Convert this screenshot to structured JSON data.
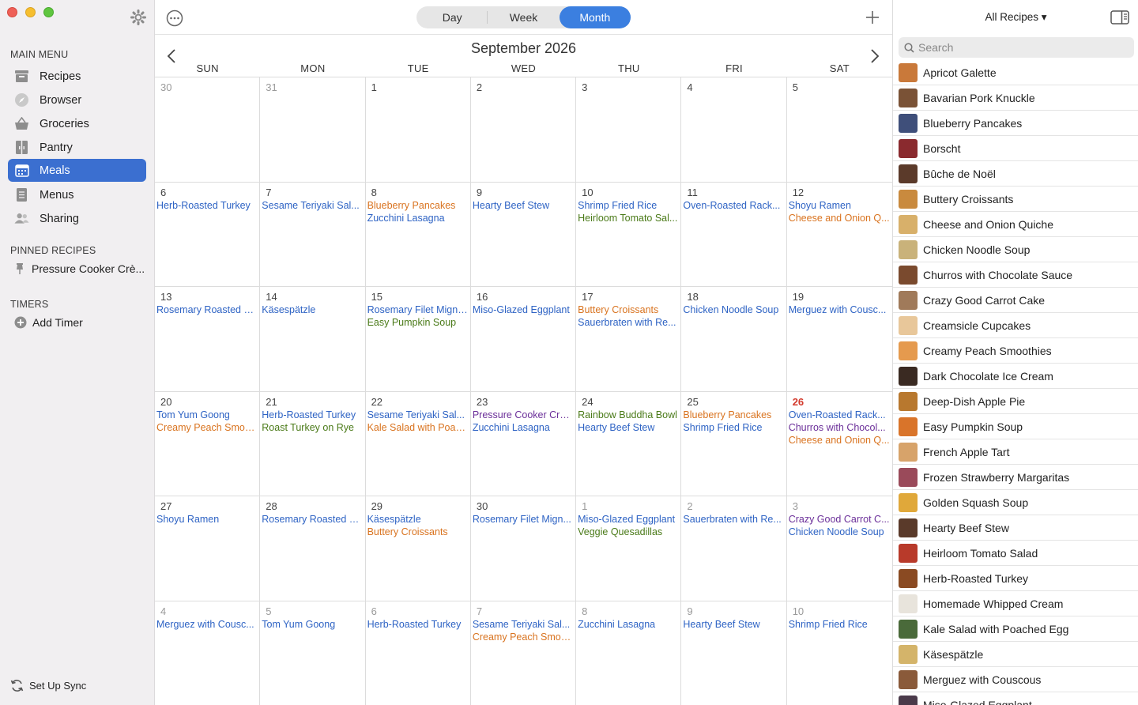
{
  "sidebar": {
    "main_menu_title": "MAIN MENU",
    "items": [
      {
        "label": "Recipes",
        "icon": "recipes-icon"
      },
      {
        "label": "Browser",
        "icon": "compass-icon"
      },
      {
        "label": "Groceries",
        "icon": "basket-icon"
      },
      {
        "label": "Pantry",
        "icon": "pantry-icon"
      },
      {
        "label": "Meals",
        "icon": "calendar-icon"
      },
      {
        "label": "Menus",
        "icon": "menu-icon"
      },
      {
        "label": "Sharing",
        "icon": "people-icon"
      }
    ],
    "active_item": "Meals",
    "pinned_title": "PINNED RECIPES",
    "pinned_item": "Pressure Cooker Crè...",
    "timers_title": "TIMERS",
    "add_timer": "Add Timer",
    "sync": "Set Up Sync"
  },
  "toolbar": {
    "view_options": [
      "Day",
      "Week",
      "Month"
    ],
    "active_view": "Month"
  },
  "calendar": {
    "title": "September 2026",
    "weekdays": [
      "SUN",
      "MON",
      "TUE",
      "WED",
      "THU",
      "FRI",
      "SAT"
    ],
    "colors": {
      "blue": "#2e63c4",
      "orange": "#d9731f",
      "green": "#4a7a18",
      "purple": "#6b2f99"
    },
    "weeks": [
      [
        {
          "day": "30",
          "dim": true,
          "meals": []
        },
        {
          "day": "31",
          "dim": true,
          "meals": []
        },
        {
          "day": "1",
          "meals": []
        },
        {
          "day": "2",
          "meals": []
        },
        {
          "day": "3",
          "meals": []
        },
        {
          "day": "4",
          "meals": []
        },
        {
          "day": "5",
          "meals": []
        }
      ],
      [
        {
          "day": "6",
          "meals": [
            {
              "name": "Herb-Roasted Turkey",
              "color": "blue"
            }
          ]
        },
        {
          "day": "7",
          "meals": [
            {
              "name": "Sesame Teriyaki Sal...",
              "color": "blue"
            }
          ]
        },
        {
          "day": "8",
          "meals": [
            {
              "name": "Blueberry Pancakes",
              "color": "orange"
            },
            {
              "name": "Zucchini Lasagna",
              "color": "blue"
            }
          ]
        },
        {
          "day": "9",
          "meals": [
            {
              "name": "Hearty Beef Stew",
              "color": "blue"
            }
          ]
        },
        {
          "day": "10",
          "meals": [
            {
              "name": "Shrimp Fried Rice",
              "color": "blue"
            },
            {
              "name": "Heirloom Tomato Sal...",
              "color": "green"
            }
          ]
        },
        {
          "day": "11",
          "meals": [
            {
              "name": "Oven-Roasted Rack...",
              "color": "blue"
            }
          ]
        },
        {
          "day": "12",
          "meals": [
            {
              "name": "Shoyu Ramen",
              "color": "blue"
            },
            {
              "name": "Cheese and Onion Q...",
              "color": "orange"
            }
          ]
        }
      ],
      [
        {
          "day": "13",
          "meals": [
            {
              "name": "Rosemary Roasted C...",
              "color": "blue"
            }
          ]
        },
        {
          "day": "14",
          "meals": [
            {
              "name": "Käsespätzle",
              "color": "blue"
            }
          ]
        },
        {
          "day": "15",
          "meals": [
            {
              "name": "Rosemary Filet Mignon",
              "color": "blue"
            },
            {
              "name": "Easy Pumpkin Soup",
              "color": "green"
            }
          ]
        },
        {
          "day": "16",
          "meals": [
            {
              "name": "Miso-Glazed Eggplant",
              "color": "blue"
            }
          ]
        },
        {
          "day": "17",
          "meals": [
            {
              "name": "Buttery Croissants",
              "color": "orange"
            },
            {
              "name": "Sauerbraten with Re...",
              "color": "blue"
            }
          ]
        },
        {
          "day": "18",
          "meals": [
            {
              "name": "Chicken Noodle Soup",
              "color": "blue"
            }
          ]
        },
        {
          "day": "19",
          "meals": [
            {
              "name": "Merguez with Cousc...",
              "color": "blue"
            }
          ]
        }
      ],
      [
        {
          "day": "20",
          "meals": [
            {
              "name": "Tom Yum Goong",
              "color": "blue"
            },
            {
              "name": "Creamy Peach Smoo...",
              "color": "orange"
            }
          ]
        },
        {
          "day": "21",
          "meals": [
            {
              "name": "Herb-Roasted Turkey",
              "color": "blue"
            },
            {
              "name": "Roast Turkey on Rye",
              "color": "green"
            }
          ]
        },
        {
          "day": "22",
          "meals": [
            {
              "name": "Sesame Teriyaki Sal...",
              "color": "blue"
            },
            {
              "name": "Kale Salad with Poac...",
              "color": "orange"
            }
          ]
        },
        {
          "day": "23",
          "meals": [
            {
              "name": "Pressure Cooker Crè...",
              "color": "purple"
            },
            {
              "name": "Zucchini Lasagna",
              "color": "blue"
            }
          ]
        },
        {
          "day": "24",
          "meals": [
            {
              "name": "Rainbow Buddha Bowl",
              "color": "green"
            },
            {
              "name": "Hearty Beef Stew",
              "color": "blue"
            }
          ]
        },
        {
          "day": "25",
          "meals": [
            {
              "name": "Blueberry Pancakes",
              "color": "orange"
            },
            {
              "name": "Shrimp Fried Rice",
              "color": "blue"
            }
          ]
        },
        {
          "day": "26",
          "today": true,
          "meals": [
            {
              "name": "Oven-Roasted Rack...",
              "color": "blue"
            },
            {
              "name": "Churros with Chocol...",
              "color": "purple"
            },
            {
              "name": "Cheese and Onion Q...",
              "color": "orange"
            }
          ]
        }
      ],
      [
        {
          "day": "27",
          "meals": [
            {
              "name": "Shoyu Ramen",
              "color": "blue"
            }
          ]
        },
        {
          "day": "28",
          "meals": [
            {
              "name": "Rosemary Roasted C...",
              "color": "blue"
            }
          ]
        },
        {
          "day": "29",
          "meals": [
            {
              "name": "Käsespätzle",
              "color": "blue"
            },
            {
              "name": "Buttery Croissants",
              "color": "orange"
            }
          ]
        },
        {
          "day": "30",
          "meals": [
            {
              "name": "Rosemary Filet Mign...",
              "color": "blue"
            }
          ]
        },
        {
          "day": "1",
          "dim": true,
          "meals": [
            {
              "name": "Miso-Glazed Eggplant",
              "color": "blue"
            },
            {
              "name": "Veggie Quesadillas",
              "color": "green"
            }
          ]
        },
        {
          "day": "2",
          "dim": true,
          "meals": [
            {
              "name": "Sauerbraten with Re...",
              "color": "blue"
            }
          ]
        },
        {
          "day": "3",
          "dim": true,
          "meals": [
            {
              "name": "Crazy Good Carrot C...",
              "color": "purple"
            },
            {
              "name": "Chicken Noodle Soup",
              "color": "blue"
            }
          ]
        }
      ],
      [
        {
          "day": "4",
          "dim": true,
          "meals": [
            {
              "name": "Merguez with Cousc...",
              "color": "blue"
            }
          ]
        },
        {
          "day": "5",
          "dim": true,
          "meals": [
            {
              "name": "Tom Yum Goong",
              "color": "blue"
            }
          ]
        },
        {
          "day": "6",
          "dim": true,
          "meals": [
            {
              "name": "Herb-Roasted Turkey",
              "color": "blue"
            }
          ]
        },
        {
          "day": "7",
          "dim": true,
          "meals": [
            {
              "name": "Sesame Teriyaki Sal...",
              "color": "blue"
            },
            {
              "name": "Creamy Peach Smoo...",
              "color": "orange"
            }
          ]
        },
        {
          "day": "8",
          "dim": true,
          "meals": [
            {
              "name": "Zucchini Lasagna",
              "color": "blue"
            }
          ]
        },
        {
          "day": "9",
          "dim": true,
          "meals": [
            {
              "name": "Hearty Beef Stew",
              "color": "blue"
            }
          ]
        },
        {
          "day": "10",
          "dim": true,
          "meals": [
            {
              "name": "Shrimp Fried Rice",
              "color": "blue"
            }
          ]
        }
      ]
    ]
  },
  "recipes_panel": {
    "filter_label": "All Recipes ▾",
    "search_placeholder": "Search",
    "recipes": [
      {
        "name": "Apricot Galette",
        "thumb": "#c9793a"
      },
      {
        "name": "Bavarian Pork Knuckle",
        "thumb": "#7a5236"
      },
      {
        "name": "Blueberry Pancakes",
        "thumb": "#3f4f7a"
      },
      {
        "name": "Borscht",
        "thumb": "#8a2a2e"
      },
      {
        "name": "Bûche de Noël",
        "thumb": "#5b3a2a"
      },
      {
        "name": "Buttery Croissants",
        "thumb": "#c98a3e"
      },
      {
        "name": "Cheese and Onion Quiche",
        "thumb": "#d8b06a"
      },
      {
        "name": "Chicken Noodle Soup",
        "thumb": "#c9b27a"
      },
      {
        "name": "Churros with Chocolate Sauce",
        "thumb": "#7a4a2e"
      },
      {
        "name": "Crazy Good Carrot Cake",
        "thumb": "#a07a5a"
      },
      {
        "name": "Creamsicle Cupcakes",
        "thumb": "#e8c79a"
      },
      {
        "name": "Creamy Peach Smoothies",
        "thumb": "#e59a4e"
      },
      {
        "name": "Dark Chocolate Ice Cream",
        "thumb": "#3a2a22"
      },
      {
        "name": "Deep-Dish Apple Pie",
        "thumb": "#b8782e"
      },
      {
        "name": "Easy Pumpkin Soup",
        "thumb": "#d9742a"
      },
      {
        "name": "French Apple Tart",
        "thumb": "#d7a36a"
      },
      {
        "name": "Frozen Strawberry Margaritas",
        "thumb": "#9a4a5a"
      },
      {
        "name": "Golden Squash Soup",
        "thumb": "#e0a83a"
      },
      {
        "name": "Hearty Beef Stew",
        "thumb": "#5a3a2a"
      },
      {
        "name": "Heirloom Tomato Salad",
        "thumb": "#b83a2a"
      },
      {
        "name": "Herb-Roasted Turkey",
        "thumb": "#8a4a22"
      },
      {
        "name": "Homemade Whipped Cream",
        "thumb": "#e8e4dc"
      },
      {
        "name": "Kale Salad with Poached Egg",
        "thumb": "#4a6a3a"
      },
      {
        "name": "Käsespätzle",
        "thumb": "#d4b46a"
      },
      {
        "name": "Merguez with Couscous",
        "thumb": "#8a5a3a"
      },
      {
        "name": "Miso-Glazed Eggplant",
        "thumb": "#4a3a4a"
      }
    ]
  }
}
